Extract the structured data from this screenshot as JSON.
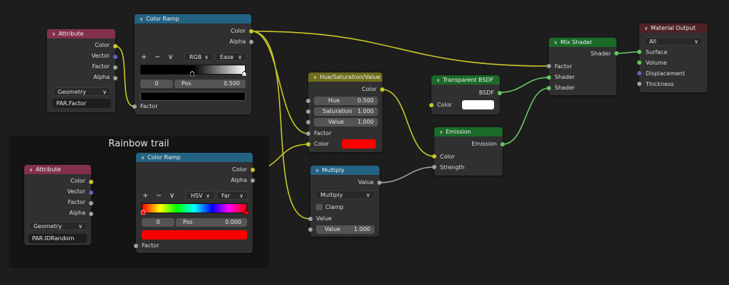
{
  "frame": {
    "title": "Rainbow trail"
  },
  "attr1": {
    "title": "Attribute",
    "outputs": [
      "Color",
      "Vector",
      "Factor",
      "Alpha"
    ],
    "type": "Geometry",
    "name": "PAR.Factor"
  },
  "ramp1": {
    "title": "Color Ramp",
    "outputs": [
      "Color",
      "Alpha"
    ],
    "add": "+",
    "remove": "−",
    "menu": "∨",
    "color_mode": "RGB",
    "interp": "Ease",
    "index": "0",
    "pos_label": "Pos",
    "pos_value": "0.500",
    "stop_color": "#000000",
    "input": "Factor"
  },
  "attr2": {
    "title": "Attribute",
    "outputs": [
      "Color",
      "Vector",
      "Factor",
      "Alpha"
    ],
    "type": "Geometry",
    "name": "PAR.IDRandom"
  },
  "ramp2": {
    "title": "Color Ramp",
    "outputs": [
      "Color",
      "Alpha"
    ],
    "add": "+",
    "remove": "−",
    "menu": "∨",
    "color_mode": "HSV",
    "interp": "Far",
    "index": "0",
    "pos_label": "Pos",
    "pos_value": "0.000",
    "stop_color": "#ff0000",
    "input": "Factor"
  },
  "hsv": {
    "title": "Hue/Saturation/Value",
    "output": "Color",
    "hue_label": "Hue",
    "hue": "0.500",
    "sat_label": "Saturation",
    "sat": "1.000",
    "val_label": "Value",
    "val": "1.000",
    "fac_label": "Factor",
    "color_label": "Color",
    "color": "#ff0000"
  },
  "multiply": {
    "title": "Multiply",
    "output": "Value",
    "operation": "Multiply",
    "clamp": "Clamp",
    "input1": "Value",
    "input2_label": "Value",
    "input2": "1.000"
  },
  "transparent": {
    "title": "Transparent BSDF",
    "output": "BSDF",
    "color_label": "Color",
    "color": "#ffffff"
  },
  "emission": {
    "title": "Emission",
    "output": "Emission",
    "color_label": "Color",
    "strength_label": "Strength"
  },
  "mix": {
    "title": "Mix Shader",
    "output": "Shader",
    "fac_label": "Factor",
    "shader1": "Shader",
    "shader2": "Shader"
  },
  "matout": {
    "title": "Material Output",
    "target": "All",
    "inputs": [
      "Surface",
      "Volume",
      "Displacement",
      "Thickness"
    ]
  },
  "colors": {
    "attribute": "#83314a",
    "converter": "#246283",
    "color": "#6e6e1d",
    "shader": "#1b6a28",
    "output": "#4e2226",
    "link_yellow": "#c7c729",
    "link_green": "#63c763",
    "link_grey": "#a1a1a1"
  }
}
